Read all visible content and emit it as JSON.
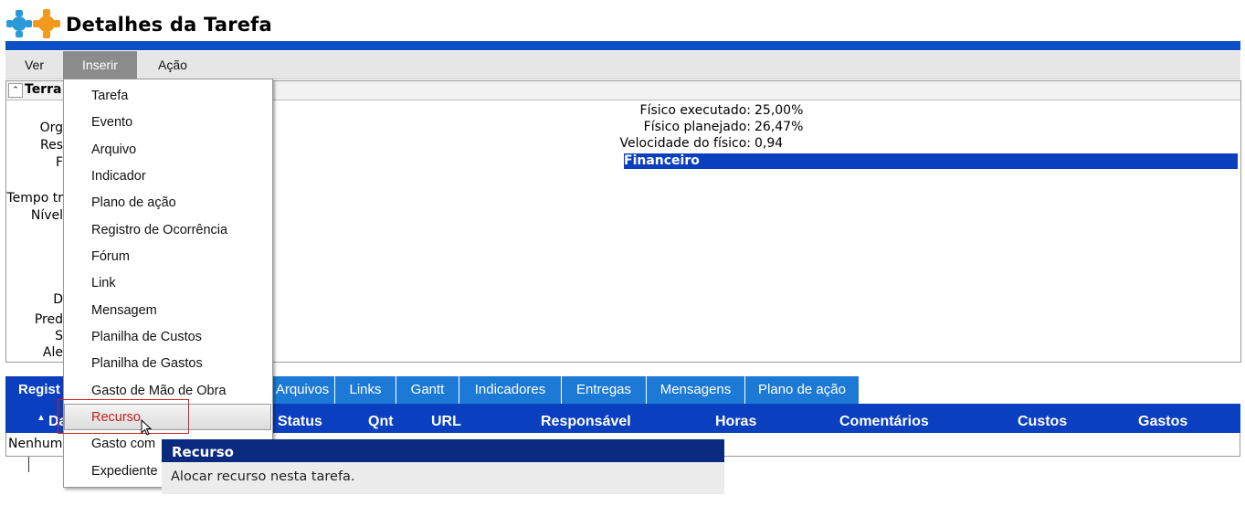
{
  "header": {
    "title": "Detalhes da Tarefa"
  },
  "menu": {
    "items": [
      "Ver",
      "Inserir",
      "Ação"
    ],
    "active": "Inserir"
  },
  "panel": {
    "title": "Terra",
    "left_labels": [
      "Org",
      "Res",
      "F",
      "Tempo tr",
      "Nível"
    ],
    "left_labels_lower": [
      "D",
      "Pred",
      "S",
      "Ale"
    ],
    "stats": [
      {
        "label": "Físico executado:",
        "value": "25,00%"
      },
      {
        "label": "Físico planejado:",
        "value": "26,47%"
      },
      {
        "label": "Velocidade do físico:",
        "value": "0,94"
      }
    ],
    "section_bar": "Financeiro"
  },
  "tabs": [
    "Regist",
    "Arquivos",
    "Links",
    "Gantt",
    "Indicadores",
    "Entregas",
    "Mensagens",
    "Plano de ação"
  ],
  "table": {
    "columns": [
      "Da",
      "Status",
      "Qnt",
      "URL",
      "Responsável",
      "Horas",
      "Comentários",
      "Custos",
      "Gastos"
    ],
    "empty_text": "Nenhum"
  },
  "dropdown": {
    "items": [
      "Tarefa",
      "Evento",
      "Arquivo",
      "Indicador",
      "Plano de ação",
      "Registro de Ocorrência",
      "Fórum",
      "Link",
      "Mensagem",
      "Planilha de Custos",
      "Planilha de Gastos",
      "Gasto de Mão de Obra",
      "Recurso",
      "Gasto com",
      "Expediente"
    ],
    "highlighted": "Recurso"
  },
  "tooltip": {
    "title": "Recurso",
    "text": "Alocar recurso nesta tarefa."
  },
  "colors": {
    "brand_blue": "#0a4fc6",
    "tab_blue": "#1c7ad6",
    "dark_blue": "#0a3fbf",
    "highlight_red": "#d62020"
  }
}
